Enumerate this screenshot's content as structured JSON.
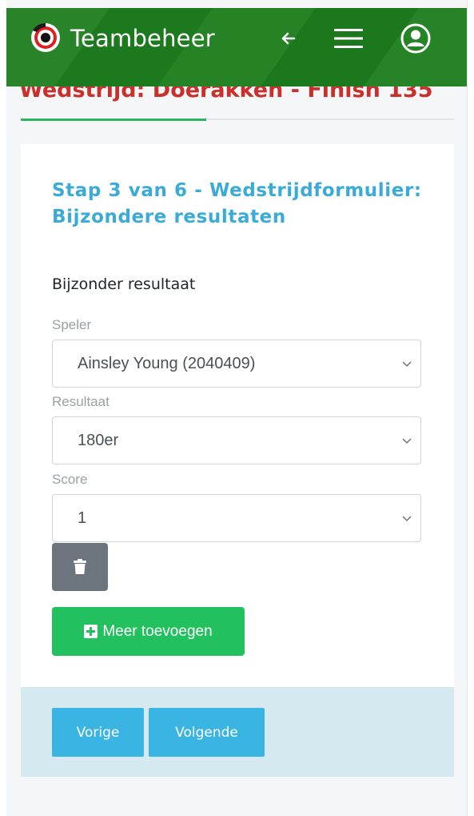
{
  "header": {
    "app_title": "Teambeheer",
    "icons": {
      "logo": "target-logo",
      "back": "arrow-left-icon",
      "menu": "hamburger-menu-icon",
      "user": "user-circle-icon"
    },
    "brand_color": "#1e7e1e"
  },
  "match_title": "Wedstrijd: Doerakken - Finish 135",
  "form": {
    "step_title": "Stap 3 van 6 - Wedstrijdformulier: Bijzondere resultaten",
    "section_label": "Bijzonder resultaat",
    "fields": {
      "speler": {
        "label": "Speler",
        "value": "Ainsley Young (2040409)"
      },
      "resultaat": {
        "label": "Resultaat",
        "value": "180er"
      },
      "score": {
        "label": "Score",
        "value": "1"
      }
    },
    "delete_icon": "trash-icon",
    "add_button_label": "Meer toevoegen",
    "add_icon": "plus-square-icon"
  },
  "navigation": {
    "previous_label": "Vorige",
    "next_label": "Volgende"
  },
  "colors": {
    "title_accent": "#3aaad8",
    "match_title": "#c9302c",
    "add_button": "#22c05f",
    "nav_button": "#3ab4e3",
    "delete_button": "#6c757d"
  }
}
